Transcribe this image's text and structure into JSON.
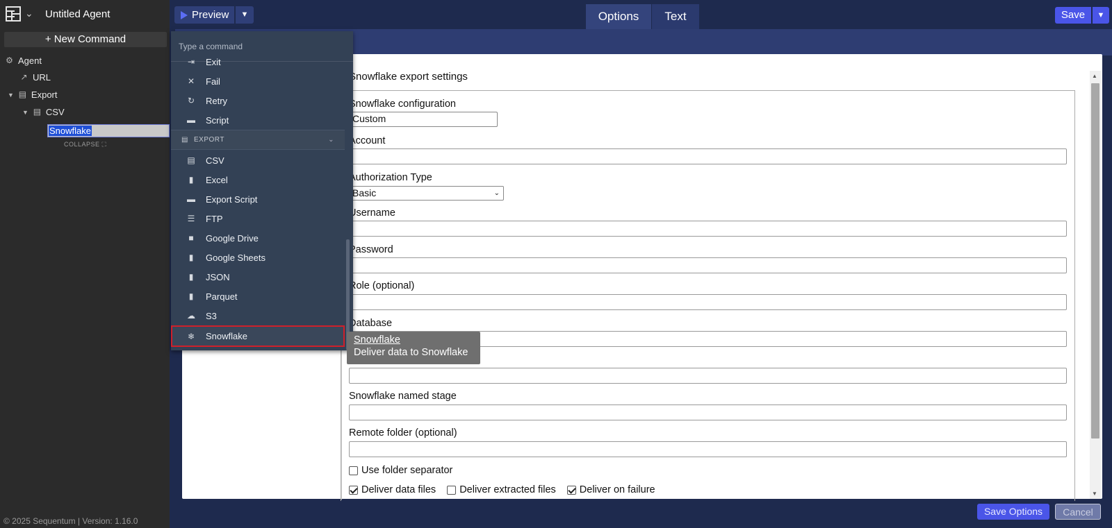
{
  "app": {
    "agent_title": "Untitled Agent",
    "new_command": "+ New Command",
    "copyright": "© 2025 Sequentum | Version: 1.16.0"
  },
  "toolbar": {
    "preview_label": "Preview",
    "tabs": [
      {
        "label": "Options",
        "active": true
      },
      {
        "label": "Text",
        "active": false
      }
    ],
    "save_label": "Save"
  },
  "tree": {
    "items": [
      {
        "label": "Agent",
        "icon": "robot-icon"
      },
      {
        "label": "URL",
        "icon": "external-link-icon"
      },
      {
        "label": "Export",
        "icon": "export-file-icon"
      },
      {
        "label": "CSV",
        "icon": "csv-file-icon"
      }
    ],
    "selected_label": "Snowflake",
    "collapse_label": "COLLAPSE"
  },
  "command_menu": {
    "placeholder": "Type a command",
    "items_top": [
      {
        "label": "Exit",
        "icon": "exit-icon"
      },
      {
        "label": "Fail",
        "icon": "x-icon"
      },
      {
        "label": "Retry",
        "icon": "retry-icon"
      },
      {
        "label": "Script",
        "icon": "script-icon"
      }
    ],
    "section_label": "EXPORT",
    "export_items": [
      {
        "label": "CSV",
        "icon": "csv-icon"
      },
      {
        "label": "Excel",
        "icon": "file-icon"
      },
      {
        "label": "Export Script",
        "icon": "script-icon"
      },
      {
        "label": "FTP",
        "icon": "server-icon"
      },
      {
        "label": "Google Drive",
        "icon": "folder-icon"
      },
      {
        "label": "Google Sheets",
        "icon": "file-icon"
      },
      {
        "label": "JSON",
        "icon": "file-icon"
      },
      {
        "label": "Parquet",
        "icon": "file-icon"
      },
      {
        "label": "S3",
        "icon": "cloud-icon"
      },
      {
        "label": "Snowflake",
        "icon": "snowflake-icon"
      }
    ],
    "highlighted": "Snowflake"
  },
  "tooltip": {
    "title": "Snowflake",
    "description": "Deliver data to Snowflake"
  },
  "form": {
    "title": "Snowflake export settings",
    "config_label": "Snowflake configuration",
    "config_value": "Custom",
    "account_label": "Account",
    "auth_label": "Authorization Type",
    "auth_value": "Basic",
    "username_label": "Username",
    "password_label": "Password",
    "role_label": "Role (optional)",
    "database_label": "Database",
    "stage_label": "Snowflake named stage",
    "remote_label": "Remote folder (optional)",
    "use_folder_separator": {
      "label": "Use folder separator",
      "checked": false
    },
    "deliver_data_files": {
      "label": "Deliver data files",
      "checked": true
    },
    "deliver_extracted_files": {
      "label": "Deliver extracted files",
      "checked": false
    },
    "deliver_on_failure": {
      "label": "Deliver on failure",
      "checked": true
    }
  },
  "footer": {
    "save_options": "Save Options",
    "cancel": "Cancel"
  },
  "colors": {
    "accent": "#4a55e8",
    "highlight_border": "#d0202a"
  }
}
